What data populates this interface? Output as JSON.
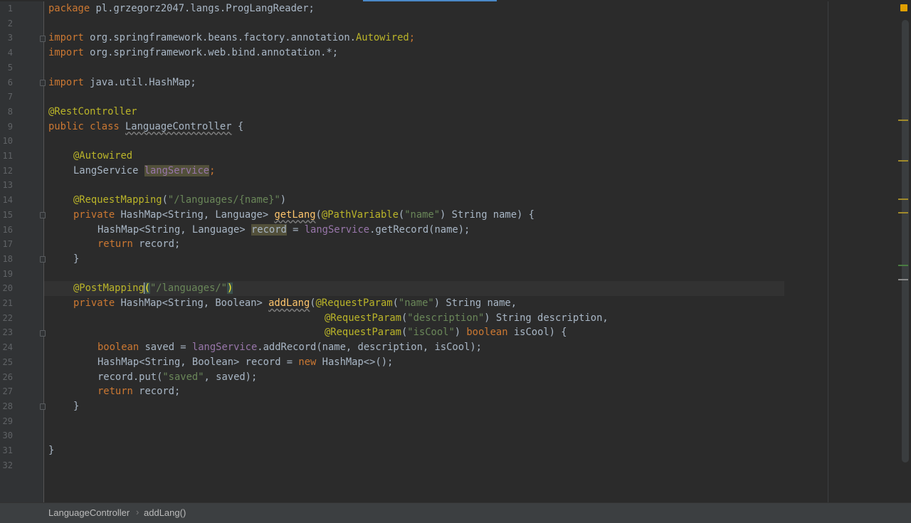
{
  "editor": {
    "line_numbers": [
      "1",
      "2",
      "3",
      "4",
      "5",
      "6",
      "7",
      "8",
      "9",
      "10",
      "11",
      "12",
      "13",
      "14",
      "15",
      "16",
      "17",
      "18",
      "19",
      "20",
      "21",
      "22",
      "23",
      "24",
      "25",
      "26",
      "27",
      "28",
      "29",
      "30",
      "31",
      "32"
    ],
    "code": {
      "l1_kw": "package",
      "l1_rest": " pl.grzegorz2047.langs.ProgLangReader;",
      "l3_kw": "import",
      "l3_pkg": " org.springframework.beans.factory.annotation.",
      "l3_cls": "Autowired",
      "l3_end": ";",
      "l4_kw": "import",
      "l4_rest": " org.springframework.web.bind.annotation.*;",
      "l6_kw": "import",
      "l6_rest": " java.util.HashMap;",
      "l8_ann": "@RestController",
      "l9_kw": "public class",
      "l9_sp": " ",
      "l9_cls": "LanguageController",
      "l9_end": " {",
      "l11_ann": "@Autowired",
      "l12_type": "LangService ",
      "l12_fld": "langService",
      "l12_end": ";",
      "l14_ann": "@RequestMapping",
      "l14_open": "(",
      "l14_str": "\"/languages/{name}\"",
      "l14_close": ")",
      "l15_kw": "private",
      "l15_type": " HashMap<String, Language> ",
      "l15_mth": "getLang",
      "l15_open": "(",
      "l15_ann": "@PathVariable",
      "l15_p1": "(",
      "l15_str": "\"name\"",
      "l15_rest": ") String name) {",
      "l16_type": "HashMap<String, Language> ",
      "l16_var": "record",
      "l16_eq": " = ",
      "l16_fld": "langService",
      "l16_rest": ".getRecord(name);",
      "l17_kw": "return",
      "l17_rest": " record;",
      "l18": "}",
      "l20_ann": "@PostMapping",
      "l20_open": "(",
      "l20_str": "\"/languages/\"",
      "l20_close": ")",
      "l21_kw": "private",
      "l21_type": " HashMap<String, Boolean> ",
      "l21_mth": "addLang",
      "l21_open": "(",
      "l21_ann": "@RequestParam",
      "l21_p1": "(",
      "l21_str": "\"name\"",
      "l21_rest": ") String name,",
      "l22_ann": "@RequestParam",
      "l22_p1": "(",
      "l22_str": "\"description\"",
      "l22_rest": ") String description,",
      "l23_ann": "@RequestParam",
      "l23_p1": "(",
      "l23_str": "\"isCool\"",
      "l23_mid": ") ",
      "l23_kw": "boolean",
      "l23_rest": " isCool) {",
      "l24_kw": "boolean",
      "l24_mid": " saved = ",
      "l24_fld": "langService",
      "l24_rest": ".addRecord(name, description, isCool);",
      "l25_type": "HashMap<String, Boolean> record = ",
      "l25_kw": "new",
      "l25_rest": " HashMap<>();",
      "l26_a": "record.put(",
      "l26_str": "\"saved\"",
      "l26_rest": ", saved);",
      "l27_kw": "return",
      "l27_rest": " record;",
      "l28": "}",
      "l31": "}"
    }
  },
  "breadcrumb": {
    "items": [
      "LanguageController",
      "addLang()"
    ]
  },
  "colors": {
    "background": "#2b2b2b",
    "keyword": "#cc7832",
    "annotation": "#bbb529",
    "string": "#6a8759",
    "field": "#9876aa",
    "method": "#ffc66d",
    "default_text": "#a9b7c6",
    "warning_stripe": "#e0a000"
  }
}
